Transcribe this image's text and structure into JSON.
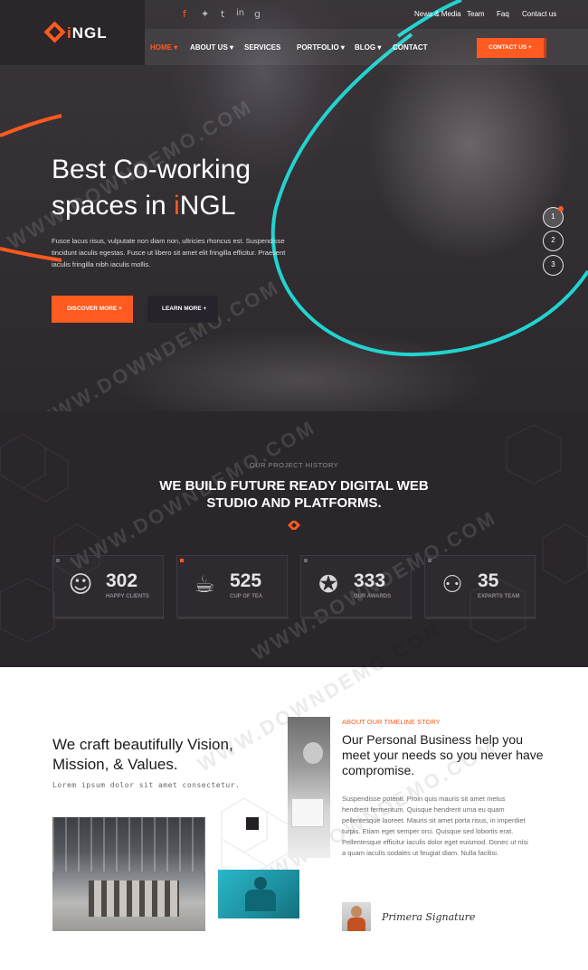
{
  "brand": {
    "logo_prefix": "i",
    "logo_rest": "NGL",
    "accent": "#ff5a1f",
    "cyan": "#22d3d0"
  },
  "topbar": {
    "social": [
      "f",
      "𝕥",
      "t",
      "in",
      "g"
    ],
    "links": [
      "News & Media",
      "Team",
      "Faq",
      "Contact us"
    ]
  },
  "nav": {
    "items": [
      "HOME",
      "ABOUT US",
      "SERVICES",
      "PORTFOLIO",
      "BLOG",
      "CONTACT"
    ],
    "contact_button": "CONTACT US +"
  },
  "hero": {
    "title_line1": "Best Co-working",
    "title_line2_prefix": "spaces in ",
    "title_line2_accent": "i",
    "title_line2_suffix": "NGL",
    "text": "Fusce lacus risus, vulputate non diam non, ultricies rhoncus est. Suspendisse tincidunt iaculis egestas. Fusce ut libero sit amet elit fringilla efficitur. Praesent iaculis fringilla nibh iaculis mollis.",
    "discover_button": "DISCOVER MORE +",
    "learn_button": "LEARN MORE +",
    "slides": [
      "1",
      "2",
      "3"
    ]
  },
  "stats": {
    "eyebrow": "OUR PROJECT HISTORY",
    "title_line1": "WE BUILD FUTURE READY DIGITAL WEB",
    "title_line2": "STUDIO AND PLATFORMS.",
    "cards": [
      {
        "icon": "baby-face-icon",
        "value": "302",
        "label": "HAPPY CLIENTS"
      },
      {
        "icon": "coffee-cup-icon",
        "value": "525",
        "label": "CUP OF TEA"
      },
      {
        "icon": "award-medal-icon",
        "value": "333",
        "label": "OUR AWARDS"
      },
      {
        "icon": "team-icon",
        "value": "35",
        "label": "EXPARTS TEAM"
      }
    ]
  },
  "about": {
    "heading_line1": "We craft beautifully Vision,",
    "heading_line2": "Mission, & Values.",
    "subtext": "Lorem ipsum dolor sit amet consectetur.",
    "eyebrow": "ABOUT OUR TIMELINE STORY",
    "heading2": "Our Personal Business help you meet your needs so you never have compromise.",
    "text": "Suspendisse potenti. Proin quis mauris sit amet metus hendrerit fermentum. Quisque hendrerit urna eu quam pellentesque laoreet. Mauris sit amet porta risus, in imperdiet turpis. Etiam eget semper orci. Quisque sed lobortis erat.",
    "text2": "Pellentesque efficitur iaculis dolor eget euismod. Donec ut nisi a quam iaculis sodales ut feugiat diam. Nulla facilisi.",
    "signature": "Primera Signature"
  },
  "watermark": "WWW.DOWNDEMO.COM"
}
